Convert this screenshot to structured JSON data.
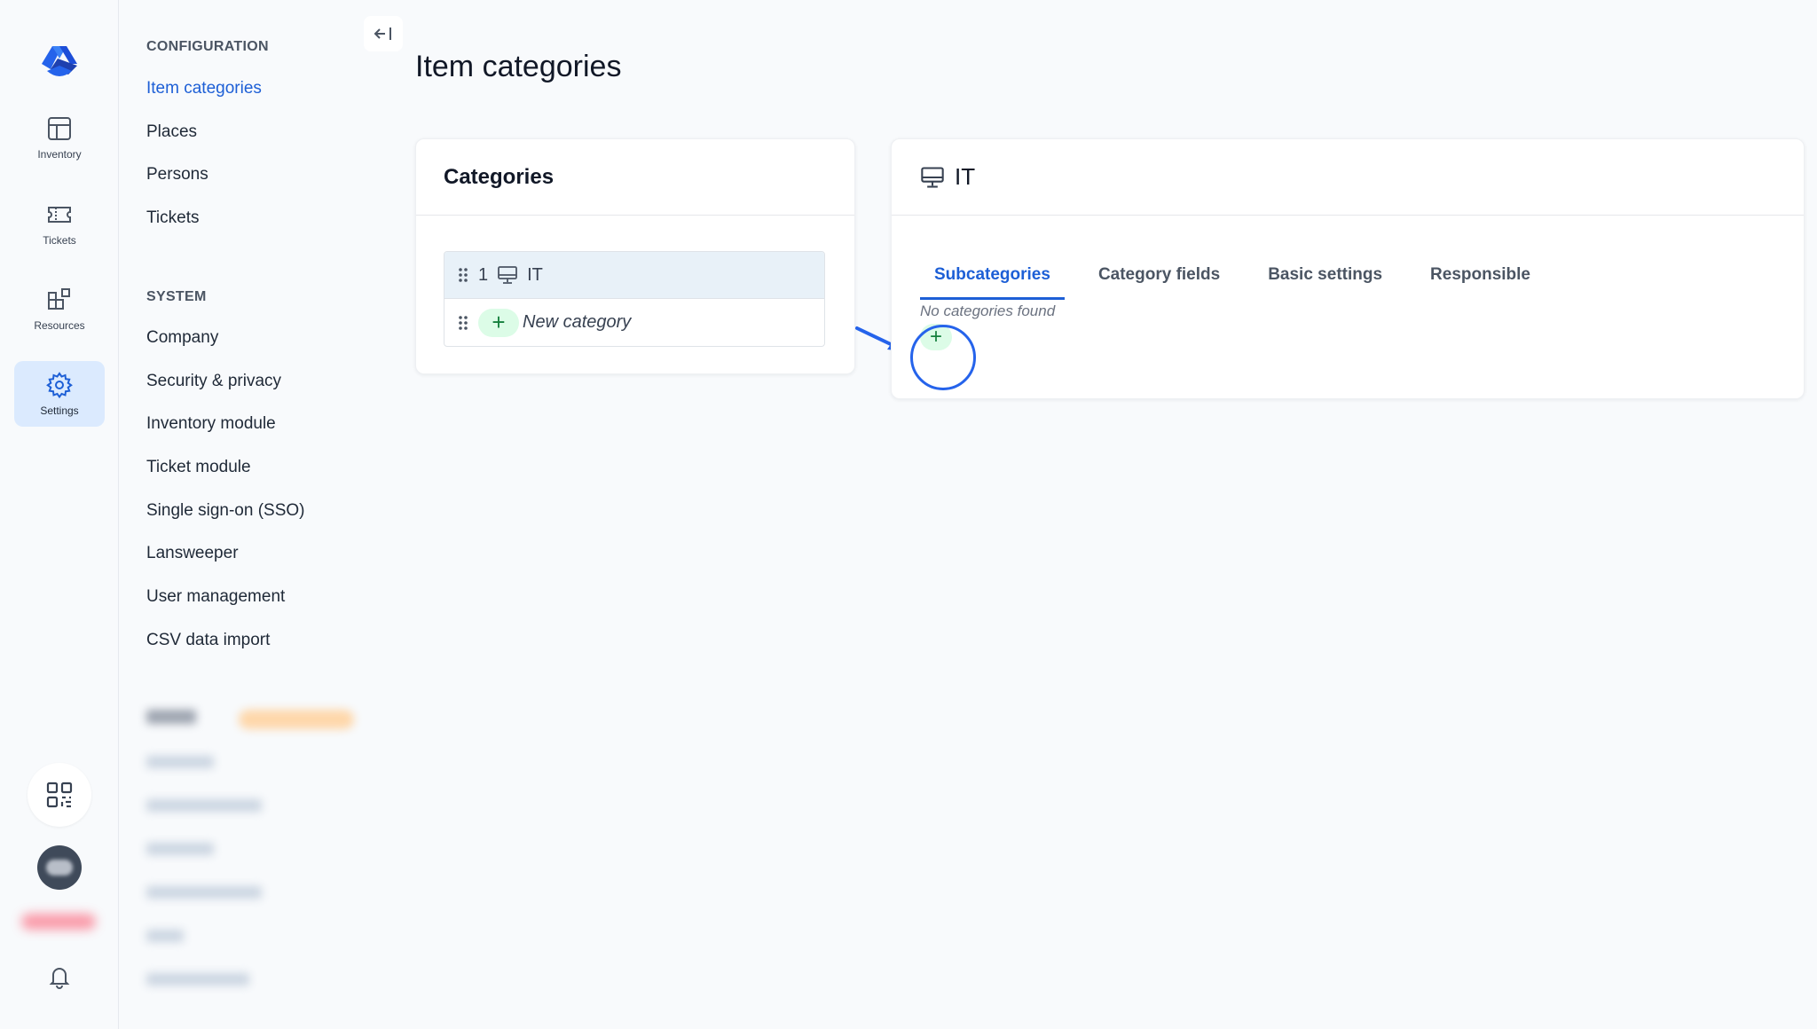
{
  "rail": {
    "items": [
      {
        "label": "Inventory",
        "icon": "inventory-icon"
      },
      {
        "label": "Tickets",
        "icon": "ticket-icon"
      },
      {
        "label": "Resources",
        "icon": "resources-icon"
      },
      {
        "label": "Settings",
        "icon": "gear-icon"
      }
    ],
    "active": "Settings",
    "bottom_icons": [
      "qr-code-icon",
      "avatar",
      "bell-icon"
    ]
  },
  "nav": {
    "configuration_heading": "CONFIGURATION",
    "configuration_items": [
      "Item categories",
      "Places",
      "Persons",
      "Tickets"
    ],
    "system_heading": "SYSTEM",
    "system_items": [
      "Company",
      "Security & privacy",
      "Inventory module",
      "Ticket module",
      "Single sign-on (SSO)",
      "Lansweeper",
      "User management",
      "CSV data import"
    ],
    "active_item": "Item categories"
  },
  "page": {
    "title": "Item categories"
  },
  "categories_card": {
    "title": "Categories",
    "rows": [
      {
        "number": "1",
        "icon": "monitor-icon",
        "name": "IT"
      }
    ],
    "new_category_label": "New category",
    "add_symbol": "+"
  },
  "detail_card": {
    "title": "IT",
    "icon": "monitor-icon",
    "tabs": [
      "Subcategories",
      "Category fields",
      "Basic settings",
      "Responsible"
    ],
    "active_tab": "Subcategories",
    "empty_message": "No categories found",
    "add_symbol": "+"
  },
  "colors": {
    "accent": "#1d5fd6",
    "add_button_bg": "#dcfce7",
    "selected_row_bg": "#e8f1f8",
    "annotation": "#2563eb"
  }
}
